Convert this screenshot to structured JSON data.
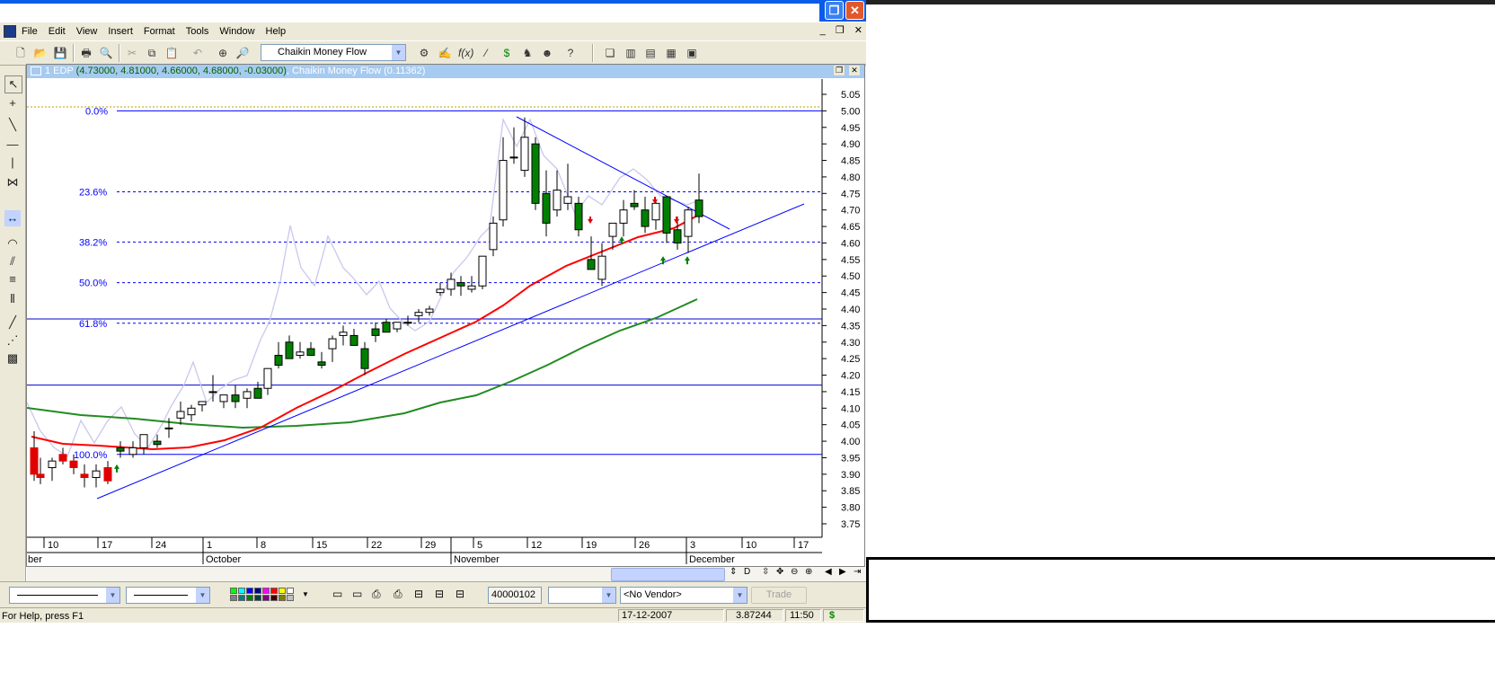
{
  "menu": {
    "items": [
      "File",
      "Edit",
      "View",
      "Insert",
      "Format",
      "Tools",
      "Window",
      "Help"
    ]
  },
  "window_buttons": {
    "restore": "❐",
    "close": "✕"
  },
  "mdi_buttons": {
    "minimize": "_",
    "restore": "❐",
    "close": "✕"
  },
  "toolbar": {
    "indicator": "Chaikin Money Flow"
  },
  "chart": {
    "title_prefix": "1 EDP",
    "ohlc": "(4.73000, 4.81000, 4.66000, 4.68000, -0.03000)",
    "indicator": "Chaikin Money Flow (0.11362)",
    "price_axis": [
      "5.05",
      "5.00",
      "4.95",
      "4.90",
      "4.85",
      "4.80",
      "4.75",
      "4.70",
      "4.65",
      "4.60",
      "4.55",
      "4.50",
      "4.45",
      "4.40",
      "4.35",
      "4.30",
      "4.25",
      "4.20",
      "4.15",
      "4.10",
      "4.05",
      "4.00",
      "3.95",
      "3.90",
      "3.85",
      "3.80",
      "3.75"
    ],
    "fib_levels": [
      {
        "label": "0.0%",
        "price": 5.0
      },
      {
        "label": "23.6%",
        "price": 4.755
      },
      {
        "label": "38.2%",
        "price": 4.603
      },
      {
        "label": "50.0%",
        "price": 4.48
      },
      {
        "label": "61.8%",
        "price": 4.357
      },
      {
        "label": "100.0%",
        "price": 3.96
      }
    ],
    "day_ticks": [
      "10",
      "17",
      "24",
      "1",
      "8",
      "15",
      "22",
      "29",
      "5",
      "12",
      "19",
      "26",
      "3",
      "10",
      "17"
    ],
    "month_labels": [
      "ber",
      "October",
      "November",
      "December"
    ]
  },
  "colors": {
    "up": "#ffffff",
    "down": "#008000",
    "ma_fast": "#ff0000",
    "ma_slow": "#228b22",
    "fib": "#0000ff",
    "trend": "#0000ff",
    "cmf": "#c8c8ee"
  },
  "bottom": {
    "code": "40000102",
    "vendor": "<No Vendor>",
    "trade": "Trade"
  },
  "status": {
    "help": "For Help, press F1",
    "date": "17-12-2007",
    "value": "3.87244",
    "time": "11:50",
    "currency": "$"
  }
}
